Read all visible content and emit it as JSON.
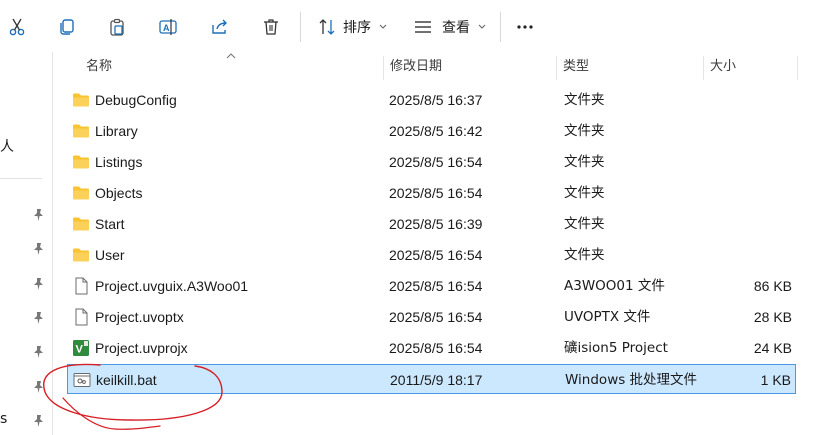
{
  "toolbar": {
    "sort_label": "排序",
    "view_label": "查看",
    "icons": [
      "cut-icon",
      "copy-icon",
      "paste-icon",
      "rename-icon",
      "share-icon",
      "delete-icon",
      "sort-icon",
      "view-icon",
      "more-icon"
    ]
  },
  "nav": {
    "text_1": "人",
    "text_2": "s"
  },
  "columns": {
    "name": "名称",
    "modified": "修改日期",
    "type": "类型",
    "size": "大小"
  },
  "files": [
    {
      "name": "DebugConfig",
      "modified": "2025/8/5 16:37",
      "type": "文件夹",
      "size": "",
      "icon": "folder-icon"
    },
    {
      "name": "Library",
      "modified": "2025/8/5 16:42",
      "type": "文件夹",
      "size": "",
      "icon": "folder-icon"
    },
    {
      "name": "Listings",
      "modified": "2025/8/5 16:54",
      "type": "文件夹",
      "size": "",
      "icon": "folder-icon"
    },
    {
      "name": "Objects",
      "modified": "2025/8/5 16:54",
      "type": "文件夹",
      "size": "",
      "icon": "folder-icon"
    },
    {
      "name": "Start",
      "modified": "2025/8/5 16:39",
      "type": "文件夹",
      "size": "",
      "icon": "folder-icon"
    },
    {
      "name": "User",
      "modified": "2025/8/5 16:54",
      "type": "文件夹",
      "size": "",
      "icon": "folder-icon"
    },
    {
      "name": "Project.uvguix.A3Woo01",
      "modified": "2025/8/5 16:54",
      "type": "A3WOO01 文件",
      "size": "86 KB",
      "icon": "file-icon"
    },
    {
      "name": "Project.uvoptx",
      "modified": "2025/8/5 16:54",
      "type": "UVOPTX 文件",
      "size": "28 KB",
      "icon": "file-icon"
    },
    {
      "name": "Project.uvprojx",
      "modified": "2025/8/5 16:54",
      "type": "礦ision5 Project",
      "size": "24 KB",
      "icon": "keil-project-icon"
    },
    {
      "name": "keilkill.bat",
      "modified": "2011/5/9 18:17",
      "type": "Windows 批处理文件",
      "size": "1 KB",
      "icon": "batch-file-icon",
      "selected": true
    }
  ],
  "colors": {
    "selection_bg": "#cce8ff",
    "selection_border": "#4a99e6",
    "folder": "#f8c431",
    "annotation": "#d61f26"
  }
}
